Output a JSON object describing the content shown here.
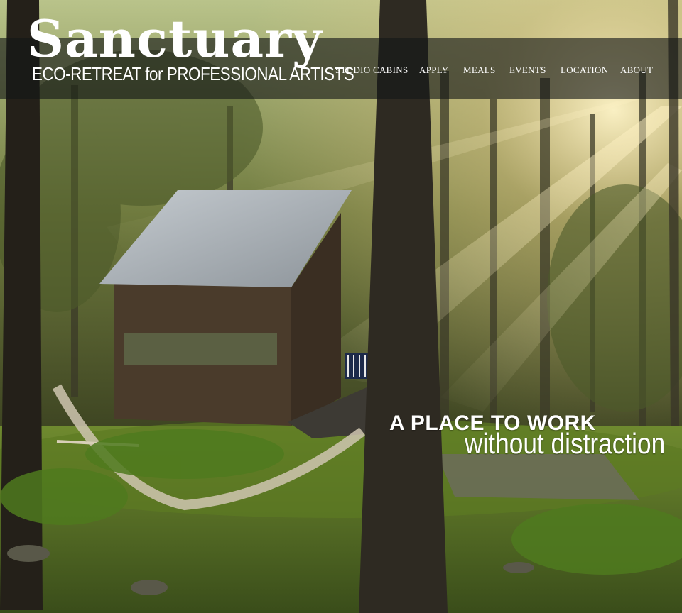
{
  "brand": {
    "title": "Sanctuary",
    "subtitle": "ECO-RETREAT for PROFESSIONAL ARTISTS"
  },
  "nav": {
    "items": [
      {
        "label": "STUDIO CABINS"
      },
      {
        "label": "APPLY"
      },
      {
        "label": "MEALS"
      },
      {
        "label": "EVENTS"
      },
      {
        "label": "LOCATION"
      },
      {
        "label": "ABOUT"
      }
    ]
  },
  "hero": {
    "tagline_line1": "A PLACE TO WORK",
    "tagline_line2": "without distraction",
    "image_subject": "forest-cabin-with-hammock-photo"
  },
  "colors": {
    "text": "#ffffff",
    "navbar_bg": "rgba(20,22,22,0.62)"
  }
}
